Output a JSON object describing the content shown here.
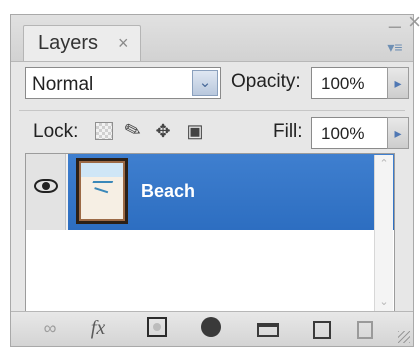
{
  "panel": {
    "title": "Layers",
    "tab_close": "×",
    "window_min": "–",
    "window_close": "×",
    "menu_icon": "panel-menu-icon"
  },
  "blend": {
    "value": "Normal",
    "arrow": "⌄"
  },
  "opacity": {
    "label": "Opacity:",
    "value": "100%",
    "arrow": "▸"
  },
  "lock": {
    "label": "Lock:"
  },
  "fill": {
    "label": "Fill:",
    "value": "100%",
    "arrow": "▸"
  },
  "layers": [
    {
      "name": "Beach",
      "visible": true,
      "selected": true
    }
  ],
  "footer": {
    "link": "link-layers-icon",
    "fx": "fx",
    "fx_text": "fx",
    "mask": "layer-mask-icon",
    "adjust": "adjustment-layer-icon",
    "group": "group-icon",
    "new": "new-layer-icon",
    "trash": "delete-layer-icon"
  }
}
